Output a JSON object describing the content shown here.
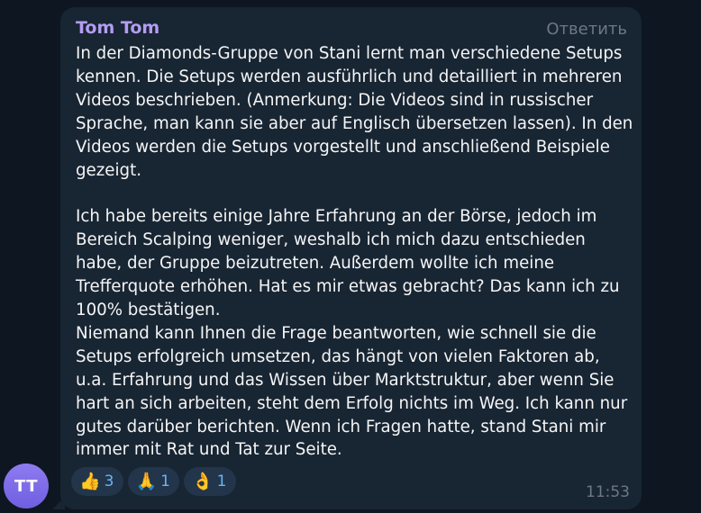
{
  "message": {
    "sender": "Tom Tom",
    "avatar_initials": "TT",
    "reply_label": "Ответить",
    "paragraphs": [
      "In der Diamonds-Gruppe von Stani lernt man verschiedene Setups kennen. Die Setups werden ausführlich und detailliert in mehreren Videos beschrieben. (Anmerkung: Die Videos sind in russischer Sprache, man kann sie aber auf Englisch übersetzen lassen). In den Videos werden die Setups vorgestellt und anschließend Beispiele gezeigt.",
      "Ich habe bereits einige Jahre Erfahrung an der Börse, jedoch im Bereich Scalping weniger, weshalb ich mich dazu entschieden habe, der Gruppe beizutreten. Außerdem wollte ich meine Trefferquote erhöhen.  Hat es mir etwas gebracht? Das kann ich zu 100% bestätigen.\nNiemand kann Ihnen die Frage beantworten, wie schnell sie die Setups erfolgreich umsetzen, das hängt von vielen Faktoren ab, u.a. Erfahrung und das Wissen über Marktstruktur, aber wenn Sie hart an sich arbeiten, steht dem Erfolg nichts im Weg. Ich kann nur gutes darüber berichten. Wenn ich Fragen hatte, stand Stani mir immer mit Rat und Tat zur Seite."
    ],
    "time": "11:53",
    "reactions": [
      {
        "emoji": "👍",
        "icon": "thumbs-up-icon",
        "count": "3"
      },
      {
        "emoji": "🙏",
        "icon": "folded-hands-icon",
        "count": "1"
      },
      {
        "emoji": "👌",
        "icon": "ok-hand-icon",
        "count": "1"
      }
    ]
  },
  "colors": {
    "background": "#0e1621",
    "bubble": "#182533",
    "sender_name": "#b49cf2",
    "text": "#f5f5f5",
    "muted": "#6d7883",
    "reaction_bg": "#22354a",
    "reaction_count": "#6ab3f3",
    "avatar": "#7f6cea"
  }
}
